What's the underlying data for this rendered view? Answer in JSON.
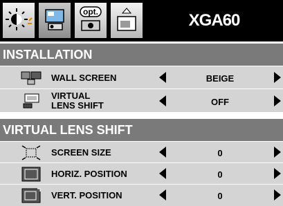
{
  "tabs": [
    {
      "icon": "brightness-sun-icon"
    },
    {
      "icon": "installation-icon"
    },
    {
      "icon": "options-icon",
      "label": "opt."
    },
    {
      "icon": "signal-icon"
    }
  ],
  "mode_label": "XGA60",
  "installation": {
    "title": "INSTALLATION",
    "rows": [
      {
        "icon": "wall-screen-icon",
        "label": "WALL SCREEN",
        "value": "BEIGE"
      },
      {
        "icon": "virtual-lens-shift-icon",
        "label_line1": "VIRTUAL",
        "label_line2": "LENS SHIFT",
        "value": "OFF"
      }
    ]
  },
  "virtual_lens_shift": {
    "title": "VIRTUAL LENS SHIFT",
    "rows": [
      {
        "icon": "screen-size-icon",
        "label": "SCREEN SIZE",
        "value": "0"
      },
      {
        "icon": "horizontal-position-icon",
        "label": "HORIZ. POSITION",
        "value": "0"
      },
      {
        "icon": "vertical-position-icon",
        "label": "VERT. POSITION",
        "value": "0"
      }
    ]
  },
  "colors": {
    "header_gray": "#7a7a7a",
    "row_gray": "#d4d4d4",
    "background": "#ffffff",
    "black": "#000000"
  }
}
